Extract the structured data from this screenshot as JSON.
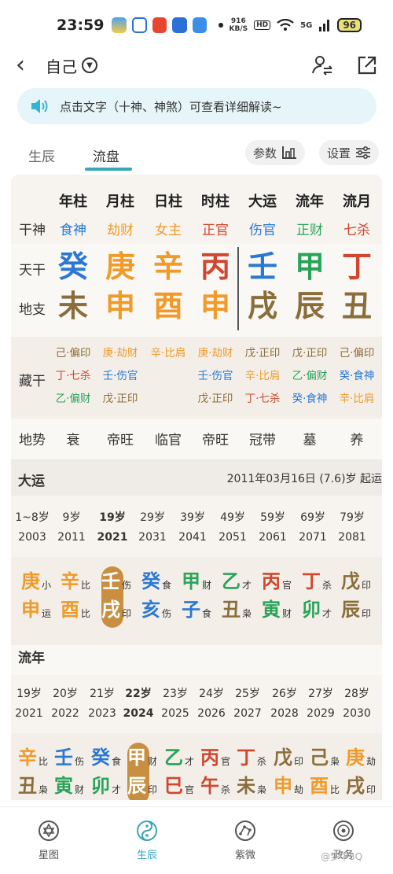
{
  "status": {
    "time": "23:59",
    "net_top": "916",
    "net_bottom": "KB/S",
    "hd": "HD",
    "signal": "5G",
    "battery": "96"
  },
  "nav": {
    "title": "自己"
  },
  "tip": {
    "text": "点击文字（十神、神煞）可查看详细解读~"
  },
  "tabs": [
    {
      "label": "生辰"
    },
    {
      "label": "流盘"
    }
  ],
  "controls": {
    "params": "参数",
    "settings": "设置"
  },
  "table": {
    "columns": [
      "年柱",
      "月柱",
      "日柱",
      "时柱",
      "大运",
      "流年",
      "流月"
    ],
    "shishen_label": "干神",
    "shishen": [
      {
        "t": "食神",
        "c": "#2b78d4"
      },
      {
        "t": "劫财",
        "c": "#f09a2a"
      },
      {
        "t": "女主",
        "c": "#f09a2a"
      },
      {
        "t": "正官",
        "c": "#d0462f"
      },
      {
        "t": "伤官",
        "c": "#2b78d4"
      },
      {
        "t": "正财",
        "c": "#2aa35a"
      },
      {
        "t": "七杀",
        "c": "#d0462f"
      }
    ],
    "tiangan_label": "天干",
    "tiangan": [
      {
        "t": "癸",
        "c": "#2b78d4"
      },
      {
        "t": "庚",
        "c": "#f09a2a"
      },
      {
        "t": "辛",
        "c": "#f09a2a"
      },
      {
        "t": "丙",
        "c": "#d0462f"
      },
      {
        "t": "壬",
        "c": "#2b78d4"
      },
      {
        "t": "甲",
        "c": "#2aa35a"
      },
      {
        "t": "丁",
        "c": "#d0462f"
      }
    ],
    "dizhi_label": "地支",
    "dizhi": [
      {
        "t": "未",
        "c": "#8a6d3b"
      },
      {
        "t": "申",
        "c": "#f09a2a"
      },
      {
        "t": "酉",
        "c": "#f09a2a"
      },
      {
        "t": "申",
        "c": "#f09a2a"
      },
      {
        "t": "戌",
        "c": "#8a6d3b"
      },
      {
        "t": "辰",
        "c": "#8a6d3b"
      },
      {
        "t": "丑",
        "c": "#8a6d3b"
      }
    ],
    "canggan_label": "藏干",
    "canggan": [
      [
        {
          "t": "己·偏印",
          "c": "#8a6d3b"
        },
        {
          "t": "丁·七杀",
          "c": "#d0462f"
        },
        {
          "t": "乙·偏财",
          "c": "#2aa35a"
        }
      ],
      [
        {
          "t": "庚·劫财",
          "c": "#f09a2a"
        },
        {
          "t": "壬·伤官",
          "c": "#2b78d4"
        },
        {
          "t": "戊·正印",
          "c": "#8a6d3b"
        }
      ],
      [
        {
          "t": "辛·比肩",
          "c": "#f09a2a"
        }
      ],
      [
        {
          "t": "庚·劫财",
          "c": "#f09a2a"
        },
        {
          "t": "壬·伤官",
          "c": "#2b78d4"
        },
        {
          "t": "戊·正印",
          "c": "#8a6d3b"
        }
      ],
      [
        {
          "t": "戊·正印",
          "c": "#8a6d3b"
        },
        {
          "t": "辛·比肩",
          "c": "#f09a2a"
        },
        {
          "t": "丁·七杀",
          "c": "#d0462f"
        }
      ],
      [
        {
          "t": "戊·正印",
          "c": "#8a6d3b"
        },
        {
          "t": "乙·偏财",
          "c": "#2aa35a"
        },
        {
          "t": "癸·食神",
          "c": "#2b78d4"
        }
      ],
      [
        {
          "t": "己·偏印",
          "c": "#8a6d3b"
        },
        {
          "t": "癸·食神",
          "c": "#2b78d4"
        },
        {
          "t": "辛·比肩",
          "c": "#f09a2a"
        }
      ]
    ],
    "dishi_label": "地势",
    "dishi": [
      "衰",
      "帝旺",
      "临官",
      "帝旺",
      "冠带",
      "墓",
      "养"
    ]
  },
  "dayun": {
    "title": "大运",
    "start": "2011年03月16日 (7.6)岁 起运",
    "ages": [
      "1~8岁",
      "9岁",
      "19岁",
      "29岁",
      "39岁",
      "49岁",
      "59岁",
      "69岁",
      "79岁"
    ],
    "years": [
      "2003",
      "2011",
      "2021",
      "2031",
      "2041",
      "2051",
      "2061",
      "2071",
      "2081"
    ],
    "selected": 2,
    "ganzhi": [
      {
        "g": "庚",
        "gc": "#f09a2a",
        "gs": "小",
        "z": "申",
        "zc": "#f09a2a",
        "zs": "运"
      },
      {
        "g": "辛",
        "gc": "#f09a2a",
        "gs": "比",
        "z": "酉",
        "zc": "#f09a2a",
        "zs": "比"
      },
      {
        "g": "壬",
        "gc": "#ffffff",
        "gs": "伤",
        "z": "戌",
        "zc": "#ffffff",
        "zs": "印"
      },
      {
        "g": "癸",
        "gc": "#2b78d4",
        "gs": "食",
        "z": "亥",
        "zc": "#2b78d4",
        "zs": "伤"
      },
      {
        "g": "甲",
        "gc": "#2aa35a",
        "gs": "财",
        "z": "子",
        "zc": "#2b78d4",
        "zs": "食"
      },
      {
        "g": "乙",
        "gc": "#2aa35a",
        "gs": "才",
        "z": "丑",
        "zc": "#8a6d3b",
        "zs": "枭"
      },
      {
        "g": "丙",
        "gc": "#d0462f",
        "gs": "官",
        "z": "寅",
        "zc": "#2aa35a",
        "zs": "财"
      },
      {
        "g": "丁",
        "gc": "#d0462f",
        "gs": "杀",
        "z": "卯",
        "zc": "#2aa35a",
        "zs": "才"
      },
      {
        "g": "戊",
        "gc": "#8a6d3b",
        "gs": "印",
        "z": "辰",
        "zc": "#8a6d3b",
        "zs": "印"
      }
    ]
  },
  "liunian": {
    "title": "流年",
    "ages": [
      "19岁",
      "20岁",
      "21岁",
      "22岁",
      "23岁",
      "24岁",
      "25岁",
      "26岁",
      "27岁",
      "28岁"
    ],
    "years": [
      "2021",
      "2022",
      "2023",
      "2024",
      "2025",
      "2026",
      "2027",
      "2028",
      "2029",
      "2030"
    ],
    "selected": 3,
    "ganzhi": [
      {
        "g": "辛",
        "gc": "#f09a2a",
        "gs": "比",
        "z": "丑",
        "zc": "#8a6d3b",
        "zs": "枭"
      },
      {
        "g": "壬",
        "gc": "#2b78d4",
        "gs": "伤",
        "z": "寅",
        "zc": "#2aa35a",
        "zs": "财"
      },
      {
        "g": "癸",
        "gc": "#2b78d4",
        "gs": "食",
        "z": "卯",
        "zc": "#2aa35a",
        "zs": "才"
      },
      {
        "g": "甲",
        "gc": "#ffffff",
        "gs": "财",
        "z": "辰",
        "zc": "#ffffff",
        "zs": "印"
      },
      {
        "g": "乙",
        "gc": "#2aa35a",
        "gs": "才",
        "z": "巳",
        "zc": "#d0462f",
        "zs": "官"
      },
      {
        "g": "丙",
        "gc": "#d0462f",
        "gs": "官",
        "z": "午",
        "zc": "#d0462f",
        "zs": "杀"
      },
      {
        "g": "丁",
        "gc": "#d0462f",
        "gs": "杀",
        "z": "未",
        "zc": "#8a6d3b",
        "zs": "枭"
      },
      {
        "g": "戊",
        "gc": "#8a6d3b",
        "gs": "印",
        "z": "申",
        "zc": "#f09a2a",
        "zs": "劫"
      },
      {
        "g": "己",
        "gc": "#8a6d3b",
        "gs": "枭",
        "z": "酉",
        "zc": "#f09a2a",
        "zs": "比"
      },
      {
        "g": "庚",
        "gc": "#f09a2a",
        "gs": "劫",
        "z": "戌",
        "zc": "#8a6d3b",
        "zs": "印"
      }
    ]
  },
  "bottom_nav": [
    {
      "label": "星图"
    },
    {
      "label": "生辰"
    },
    {
      "label": "紫微"
    },
    {
      "label": "政务"
    }
  ],
  "watermark": "@梦中8Q"
}
